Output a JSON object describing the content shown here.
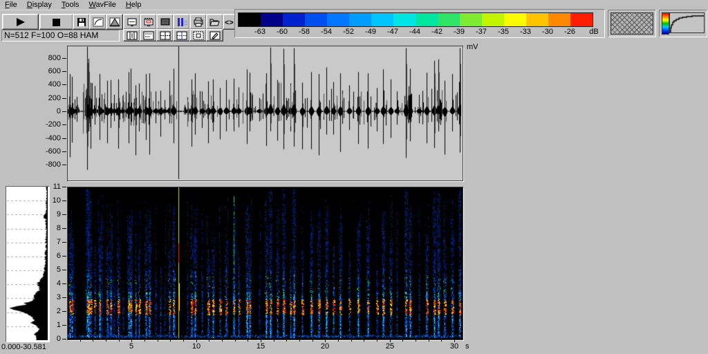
{
  "menu": {
    "items": [
      {
        "label": "File",
        "key": "F"
      },
      {
        "label": "Display",
        "key": "D"
      },
      {
        "label": "Tools",
        "key": "T"
      },
      {
        "label": "WavFile",
        "key": "W"
      },
      {
        "label": "Help",
        "key": "H"
      }
    ]
  },
  "toolbar": {
    "status_text": "N=512 F=100 O=88 HAM",
    "row1": [
      {
        "name": "play-button",
        "icon": "play-icon",
        "x": 3,
        "w": 51
      },
      {
        "name": "stop-button",
        "icon": "stop-icon",
        "x": 57,
        "w": 47
      },
      {
        "name": "save-button",
        "icon": "floppy-icon",
        "x": 105,
        "w": 23
      },
      {
        "name": "palette-curve-button",
        "icon": "gamma-curve-icon",
        "x": 129,
        "w": 23
      },
      {
        "name": "window-function-button",
        "icon": "triangle-window-icon",
        "x": 153,
        "w": 23
      },
      {
        "name": "view-spectrogram-button",
        "icon": "monitor-line-icon",
        "x": 178,
        "w": 23
      },
      {
        "name": "view-scroll-button",
        "icon": "monitor-dashed-icon",
        "x": 202,
        "w": 23
      },
      {
        "name": "view-texture-button",
        "icon": "hatched-screen-icon",
        "x": 226,
        "w": 23
      },
      {
        "name": "view-levels-button",
        "icon": "blue-bars-icon",
        "x": 250,
        "w": 23
      },
      {
        "name": "print-button",
        "icon": "printer-icon",
        "x": 274,
        "w": 23
      },
      {
        "name": "open-file-button",
        "icon": "open-folder-icon",
        "x": 298,
        "w": 23
      },
      {
        "name": "scroll-arrows-button",
        "icon": "angle-brackets-icon",
        "x": 322,
        "w": 17
      }
    ],
    "row2": [
      {
        "name": "layout-panes-button",
        "icon": "grid-bars-icon",
        "x": 178,
        "w": 23
      },
      {
        "name": "layout-dotted-button",
        "icon": "grid-dashed-icon",
        "x": 202,
        "w": 23
      },
      {
        "name": "layout-quad-button",
        "icon": "grid-cross-icon",
        "x": 226,
        "w": 23
      },
      {
        "name": "layout-quad-alt-button",
        "icon": "grid-cross-blue-icon",
        "x": 250,
        "w": 23
      },
      {
        "name": "layout-single-button",
        "icon": "square-in-square-icon",
        "x": 274,
        "w": 23
      },
      {
        "name": "annotate-button",
        "icon": "pencil-icon",
        "x": 298,
        "w": 23
      }
    ]
  },
  "colorbar": {
    "unit": "dB",
    "labels": [
      "-63",
      "-60",
      "-58",
      "-54",
      "-52",
      "-49",
      "-47",
      "-44",
      "-42",
      "-39",
      "-37",
      "-35",
      "-33",
      "-30",
      "-26"
    ],
    "colors": [
      "#000000",
      "#000088",
      "#0022cc",
      "#0050ee",
      "#0077ff",
      "#009dff",
      "#00c4ff",
      "#00e4e4",
      "#00e6a0",
      "#2ee368",
      "#7eeb32",
      "#c2f400",
      "#fbfb00",
      "#ffc400",
      "#ff8800",
      "#ff1e00"
    ]
  },
  "waveform": {
    "unit": "mV",
    "y_ticks": [
      "800",
      "600",
      "400",
      "200",
      "0",
      "-200",
      "-400",
      "-600",
      "-800"
    ]
  },
  "spectrogram": {
    "freq_ticks": [
      "0",
      "1",
      "2",
      "3",
      "4",
      "5",
      "6",
      "7",
      "8",
      "9",
      "10",
      "11"
    ],
    "time_ticks": [
      "5",
      "10",
      "15",
      "20",
      "25",
      "30"
    ],
    "time_unit": "s"
  },
  "histogram": {
    "range_label": "0.000-30.581"
  },
  "chart_data": {
    "type": "heatmap",
    "title": "spectrogram with waveform and average spectrum",
    "time_range_s": [
      0,
      30.581
    ],
    "freq_range_khz": [
      0,
      11
    ],
    "amplitude_range_mv": [
      -900,
      900
    ],
    "db_scale": [
      -63,
      -60,
      -58,
      -54,
      -52,
      -49,
      -47,
      -44,
      -42,
      -39,
      -37,
      -35,
      -33,
      -30,
      -26
    ],
    "events": [
      [
        0.15,
        560,
        690
      ],
      [
        0.3,
        520,
        470
      ],
      [
        0.55,
        180,
        120
      ],
      [
        1.5,
        970,
        880
      ],
      [
        1.62,
        790,
        300
      ],
      [
        1.8,
        430,
        560
      ],
      [
        2.1,
        380,
        200
      ],
      [
        2.45,
        560,
        430
      ],
      [
        2.62,
        210,
        150
      ],
      [
        3.05,
        460,
        480
      ],
      [
        3.35,
        470,
        250
      ],
      [
        3.6,
        250,
        150
      ],
      [
        3.95,
        480,
        560
      ],
      [
        4.3,
        160,
        100
      ],
      [
        4.72,
        590,
        480
      ],
      [
        4.88,
        640,
        210
      ],
      [
        5.25,
        390,
        660
      ],
      [
        5.55,
        420,
        300
      ],
      [
        6.05,
        560,
        430
      ],
      [
        6.35,
        570,
        650
      ],
      [
        6.8,
        300,
        180
      ],
      [
        7.2,
        310,
        380
      ],
      [
        7.55,
        170,
        120
      ],
      [
        7.9,
        460,
        180
      ],
      [
        8.2,
        640,
        480
      ],
      [
        8.62,
        1000,
        1000,
        "yellow-line"
      ],
      [
        9.3,
        210,
        150
      ],
      [
        9.6,
        480,
        530
      ],
      [
        9.9,
        570,
        350
      ],
      [
        10.4,
        300,
        250
      ],
      [
        10.9,
        450,
        480
      ],
      [
        11.3,
        480,
        300
      ],
      [
        11.8,
        350,
        420
      ],
      [
        12.3,
        470,
        300
      ],
      [
        12.88,
        490,
        300,
        "green-line"
      ],
      [
        13.3,
        360,
        240
      ],
      [
        13.9,
        630,
        490
      ],
      [
        14.15,
        580,
        300
      ],
      [
        14.9,
        200,
        150
      ],
      [
        15.4,
        570,
        520
      ],
      [
        15.75,
        960,
        300
      ],
      [
        16.3,
        470,
        440
      ],
      [
        16.75,
        940,
        570
      ],
      [
        17.3,
        420,
        300
      ],
      [
        17.55,
        950,
        530
      ],
      [
        18.2,
        430,
        570
      ],
      [
        18.9,
        590,
        570
      ],
      [
        19.5,
        560,
        660
      ],
      [
        20.1,
        660,
        350
      ],
      [
        20.65,
        440,
        350
      ],
      [
        21.2,
        570,
        610
      ],
      [
        21.9,
        390,
        280
      ],
      [
        22.55,
        590,
        490
      ],
      [
        23.3,
        570,
        560
      ],
      [
        24.0,
        350,
        300
      ],
      [
        24.5,
        630,
        490
      ],
      [
        25.1,
        480,
        400
      ],
      [
        25.6,
        300,
        200
      ],
      [
        26.3,
        950,
        700
      ],
      [
        26.6,
        640,
        450
      ],
      [
        27.3,
        250,
        180
      ],
      [
        27.9,
        580,
        480
      ],
      [
        28.5,
        760,
        550
      ],
      [
        28.8,
        780,
        300
      ],
      [
        29.3,
        460,
        650
      ],
      [
        29.9,
        560,
        300
      ],
      [
        30.45,
        950,
        620
      ]
    ],
    "avg_spectrum": [
      [
        0,
        0.3
      ],
      [
        0.2,
        0.27
      ],
      [
        0.35,
        0.34
      ],
      [
        0.5,
        0.3
      ],
      [
        0.7,
        0.22
      ],
      [
        0.9,
        0.24
      ],
      [
        1.1,
        0.3
      ],
      [
        1.25,
        0.44
      ],
      [
        1.4,
        0.34
      ],
      [
        1.6,
        0.38
      ],
      [
        1.8,
        0.48
      ],
      [
        2.0,
        0.6
      ],
      [
        2.15,
        0.82
      ],
      [
        2.3,
        0.97
      ],
      [
        2.45,
        0.8
      ],
      [
        2.55,
        0.52
      ],
      [
        2.65,
        0.62
      ],
      [
        2.8,
        0.4
      ],
      [
        3.0,
        0.34
      ],
      [
        3.2,
        0.38
      ],
      [
        3.4,
        0.27
      ],
      [
        3.6,
        0.2
      ],
      [
        3.8,
        0.23
      ],
      [
        4.1,
        0.26
      ],
      [
        4.35,
        0.16
      ],
      [
        4.6,
        0.11
      ],
      [
        5.0,
        0.085
      ],
      [
        5.5,
        0.07
      ],
      [
        6.0,
        0.06
      ],
      [
        6.5,
        0.05
      ],
      [
        7.0,
        0.045
      ],
      [
        7.5,
        0.04
      ],
      [
        8.2,
        0.04
      ],
      [
        8.6,
        0.05
      ],
      [
        8.85,
        0.11
      ],
      [
        9.1,
        0.045
      ],
      [
        9.6,
        0.035
      ],
      [
        10.2,
        0.03
      ],
      [
        10.8,
        0.03
      ],
      [
        11,
        0.035
      ]
    ]
  }
}
